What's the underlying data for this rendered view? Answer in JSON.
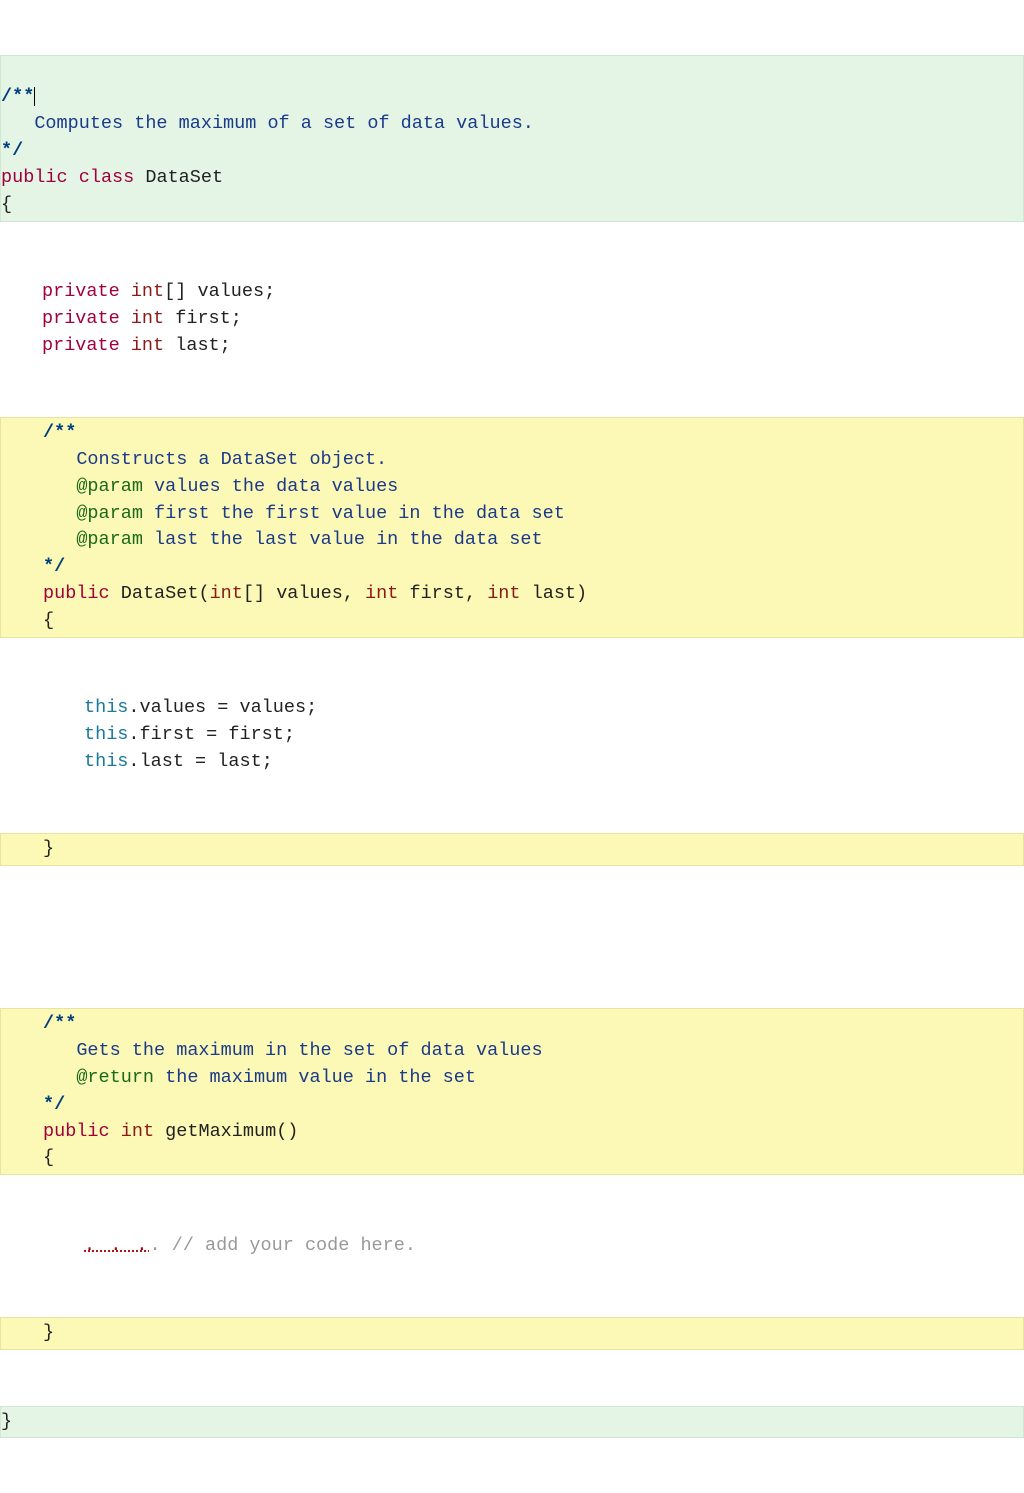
{
  "topComment": {
    "open": "/**",
    "line1": "Computes the maximum of a set of data values.",
    "close": "*/"
  },
  "classDecl": {
    "kwPublic": "public",
    "kwClass": "class",
    "name": "DataSet",
    "open": "{",
    "close": "}"
  },
  "fields": {
    "private": "private",
    "intType": "int",
    "arrBrackets": "[]",
    "f1": "values",
    "f2": "first",
    "f3": "last",
    "semi": ";"
  },
  "ctorDoc": {
    "open": "/**",
    "line1": "Constructs a DataSet object.",
    "tagParam": "@param",
    "p1": "values the data values",
    "p2": "first the first value in the data set",
    "p3": "last the last value in the data set",
    "close": "*/"
  },
  "ctor": {
    "kwPublic": "public",
    "name": "DataSet",
    "lparen": "(",
    "rparen": ")",
    "comma": ", ",
    "intType": "int",
    "arrBrackets": "[]",
    "p1": "values",
    "p2": "first",
    "p3": "last",
    "open": "{",
    "close": "}"
  },
  "ctorBody": {
    "thisKw": "this",
    "dot": ".",
    "eq": " = ",
    "v": "values",
    "f": "first",
    "l": "last",
    "semi": ";"
  },
  "maxDoc": {
    "open": "/**",
    "line1": "Gets the maximum in the set of data values",
    "tagReturn": "@return",
    "r1": "the maximum value in the set",
    "close": "*/"
  },
  "maxMethod": {
    "kwPublic": "public",
    "intType": "int",
    "name": "getMaximum",
    "parens": "()",
    "open": "{",
    "close": "}"
  },
  "placeholder": {
    "dots": ". . .",
    "hint": ". // add your code here."
  }
}
